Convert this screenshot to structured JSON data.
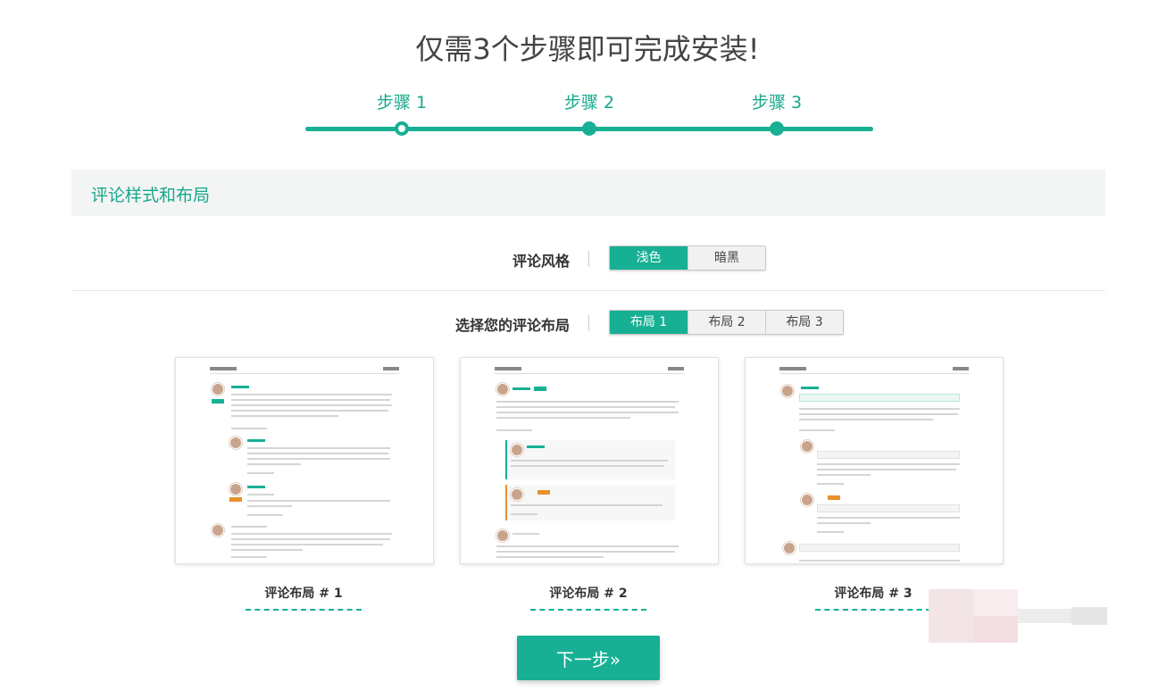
{
  "page": {
    "title": "仅需3个步骤即可完成安装!"
  },
  "stepper": {
    "steps": [
      {
        "label": "步骤 1"
      },
      {
        "label": "步骤 2"
      },
      {
        "label": "步骤 3"
      }
    ],
    "current": 1
  },
  "section": {
    "title": "评论样式和布局"
  },
  "style_row": {
    "label": "评论风格",
    "options": [
      "浅色",
      "暗黑"
    ],
    "selected": "浅色"
  },
  "layout_row": {
    "label": "选择您的评论布局",
    "options": [
      "布局 1",
      "布局 2",
      "布局 3"
    ],
    "selected": "布局 1"
  },
  "layouts": [
    {
      "caption": "评论布局 # 1"
    },
    {
      "caption": "评论布局 # 2"
    },
    {
      "caption": "评论布局 # 3"
    }
  ],
  "next_button": {
    "label": "下一步»"
  },
  "colors": {
    "accent": "#17b094",
    "secondary": "#e8912d",
    "section_bg": "#f3f4f4"
  }
}
